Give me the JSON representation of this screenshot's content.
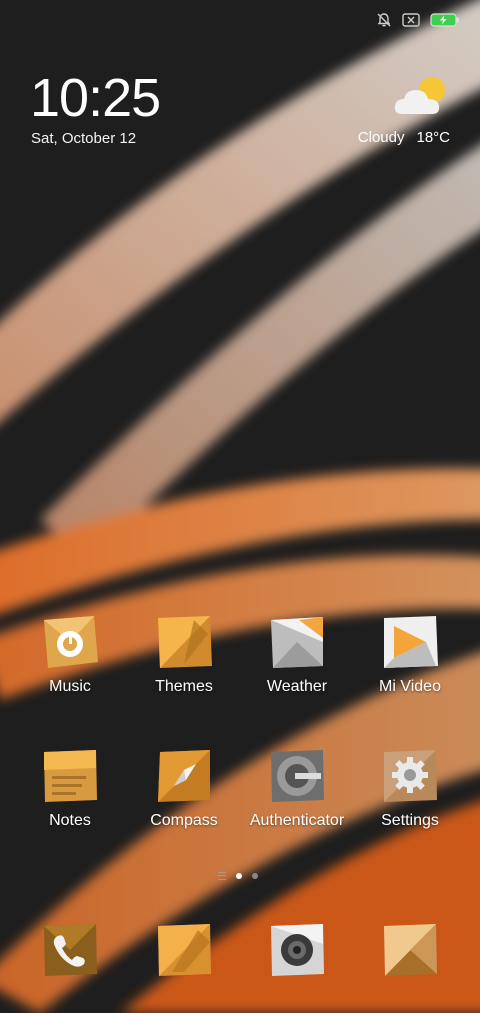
{
  "status_bar": {
    "icons": [
      "mute-bell-icon",
      "sim-x-icon",
      "battery-charging-icon"
    ]
  },
  "clock": {
    "time": "10:25",
    "date": "Sat, October 12"
  },
  "weather": {
    "condition": "Cloudy",
    "temperature": "18°C",
    "icon": "cloud-sun-icon"
  },
  "apps": [
    {
      "label": "Music",
      "icon": "music-icon"
    },
    {
      "label": "Themes",
      "icon": "themes-icon"
    },
    {
      "label": "Weather",
      "icon": "weather-app-icon"
    },
    {
      "label": "Mi Video",
      "icon": "video-play-icon"
    },
    {
      "label": "Notes",
      "icon": "notes-icon"
    },
    {
      "label": "Compass",
      "icon": "compass-icon"
    },
    {
      "label": "Authenticator",
      "icon": "authenticator-icon"
    },
    {
      "label": "Settings",
      "icon": "gear-icon"
    }
  ],
  "pager": {
    "pages": 2,
    "current": 1
  },
  "dock": [
    "phone-icon",
    "messages-icon",
    "camera-icon",
    "browser-icon"
  ],
  "colors": {
    "accent_orange": "#f39c3a",
    "battery_green": "#3ecf4f"
  }
}
